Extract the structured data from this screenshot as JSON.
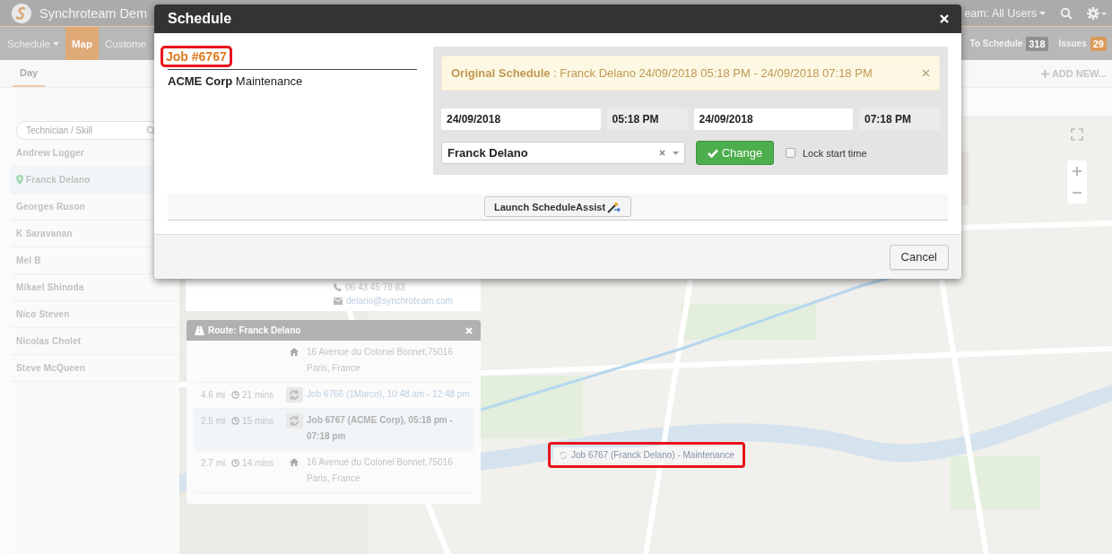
{
  "app_header": {
    "title": "Synchroteam Dem",
    "team_filter": "eam: All Users"
  },
  "nav": {
    "items": [
      {
        "label": "Schedule",
        "selected": false,
        "dropdown": true
      },
      {
        "label": "Map",
        "selected": true,
        "dropdown": false
      },
      {
        "label": "Custome",
        "selected": false,
        "dropdown": false
      }
    ],
    "counters": [
      {
        "label": "To Schedule",
        "count": "318",
        "kind": "neutral"
      },
      {
        "label": "Issues",
        "count": "29",
        "kind": "warning"
      }
    ]
  },
  "view_tabs": [
    {
      "label": "Day",
      "selected": true
    }
  ],
  "add_new": "ADD NEW...",
  "sidebar": {
    "search_placeholder": "Technician / Skill",
    "technicians": [
      {
        "name": "Andrew Lugger",
        "selected": false
      },
      {
        "name": "Franck Delano",
        "selected": true
      },
      {
        "name": "Georges Ruson",
        "selected": false
      },
      {
        "name": "K Saravanan",
        "selected": false
      },
      {
        "name": "Mel B",
        "selected": false
      },
      {
        "name": "Mikael Shinoda",
        "selected": false
      },
      {
        "name": "Nico Steven",
        "selected": false
      },
      {
        "name": "Nicolas Cholet",
        "selected": false
      },
      {
        "name": "Steve McQueen",
        "selected": false
      }
    ]
  },
  "map": {
    "contact": {
      "phone": "06 43 45 78 83",
      "email": "delano@synchroteam.com"
    },
    "route": {
      "title": "Route: Franck Delano",
      "stops": [
        {
          "kind": "home",
          "text": "16 Avenue du Colonel Bonnet,75016 Paris, France",
          "selected": false
        },
        {
          "kind": "job",
          "distance": "4.6 mi",
          "duration": "21 mins",
          "text": "Job 6766 (1Marco), 10:48 am - 12:48 pm",
          "selected": false
        },
        {
          "kind": "job",
          "distance": "2.5 mi",
          "duration": "15 mins",
          "text": "Job 6767 (ACME Corp), 05:18 pm - 07:18 pm",
          "selected": true
        },
        {
          "kind": "home",
          "distance": "2.7 mi",
          "duration": "14 mins",
          "text": "16 Avenue du Colonel Bonnet,75016 Paris, France",
          "selected": false
        }
      ]
    },
    "tooltip": {
      "text": "Job 6767 (Franck Delano) - Maintenance",
      "highlighted": true
    }
  },
  "modal": {
    "title": "Schedule",
    "job_number": {
      "text": "Job #6767",
      "highlighted": true
    },
    "job_summary": "**ACME Corp** Maintenance",
    "original_schedule": {
      "label": "Original Schedule",
      "text": ": Franck Delano 24/09/2018 05:18 PM - 24/09/2018 07:18 PM"
    },
    "start_date": "24/09/2018",
    "start_time": "05:18 PM",
    "end_date": "24/09/2018",
    "end_time": "07:18 PM",
    "technician": "Franck Delano",
    "change_button": "Change",
    "lock_start_time": {
      "label": "Lock start time",
      "checked": false
    },
    "assist_button": "Launch ScheduleAssist",
    "cancel_button": "Cancel"
  }
}
